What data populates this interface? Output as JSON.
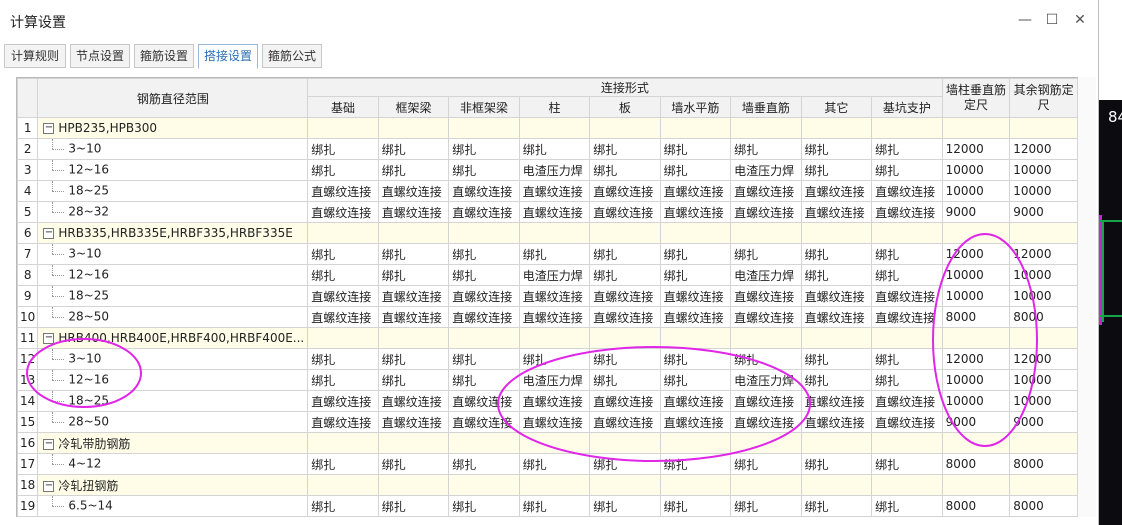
{
  "window": {
    "title": "计算设置",
    "minimize_glyph": "—",
    "maximize_glyph": "☐",
    "close_glyph": "✕"
  },
  "background": {
    "side_number": "84"
  },
  "tabs": [
    {
      "label": "计算规则",
      "active": false
    },
    {
      "label": "节点设置",
      "active": false
    },
    {
      "label": "箍筋设置",
      "active": false
    },
    {
      "label": "搭接设置",
      "active": true
    },
    {
      "label": "箍筋公式",
      "active": false
    }
  ],
  "table": {
    "header_range": "钢筋直径范围",
    "header_group": "连接形式",
    "header_wall_col": "墙柱垂直筋定尺",
    "header_other": "其余钢筋定尺",
    "columns": [
      "基础",
      "框架梁",
      "非框架梁",
      "柱",
      "板",
      "墙水平筋",
      "墙垂直筋",
      "其它",
      "基坑支护"
    ],
    "rows": [
      {
        "n": "1",
        "group": true,
        "label": "HPB235,HPB300"
      },
      {
        "n": "2",
        "label": "3~10",
        "cells": [
          "绑扎",
          "绑扎",
          "绑扎",
          "绑扎",
          "绑扎",
          "绑扎",
          "绑扎",
          "绑扎",
          "绑扎"
        ],
        "wall": "12000",
        "other": "12000"
      },
      {
        "n": "3",
        "label": "12~16",
        "cells": [
          "绑扎",
          "绑扎",
          "绑扎",
          "电渣压力焊",
          "绑扎",
          "绑扎",
          "电渣压力焊",
          "绑扎",
          "绑扎"
        ],
        "wall": "10000",
        "other": "10000"
      },
      {
        "n": "4",
        "label": "18~25",
        "cells": [
          "直螺纹连接",
          "直螺纹连接",
          "直螺纹连接",
          "直螺纹连接",
          "直螺纹连接",
          "直螺纹连接",
          "直螺纹连接",
          "直螺纹连接",
          "直螺纹连接"
        ],
        "wall": "10000",
        "other": "10000"
      },
      {
        "n": "5",
        "label": "28~32",
        "cells": [
          "直螺纹连接",
          "直螺纹连接",
          "直螺纹连接",
          "直螺纹连接",
          "直螺纹连接",
          "直螺纹连接",
          "直螺纹连接",
          "直螺纹连接",
          "直螺纹连接"
        ],
        "wall": "9000",
        "other": "9000"
      },
      {
        "n": "6",
        "group": true,
        "label": "HRB335,HRB335E,HRBF335,HRBF335E"
      },
      {
        "n": "7",
        "label": "3~10",
        "cells": [
          "绑扎",
          "绑扎",
          "绑扎",
          "绑扎",
          "绑扎",
          "绑扎",
          "绑扎",
          "绑扎",
          "绑扎"
        ],
        "wall": "12000",
        "other": "12000"
      },
      {
        "n": "8",
        "label": "12~16",
        "cells": [
          "绑扎",
          "绑扎",
          "绑扎",
          "电渣压力焊",
          "绑扎",
          "绑扎",
          "电渣压力焊",
          "绑扎",
          "绑扎"
        ],
        "wall": "10000",
        "other": "10000"
      },
      {
        "n": "9",
        "label": "18~25",
        "cells": [
          "直螺纹连接",
          "直螺纹连接",
          "直螺纹连接",
          "直螺纹连接",
          "直螺纹连接",
          "直螺纹连接",
          "直螺纹连接",
          "直螺纹连接",
          "直螺纹连接"
        ],
        "wall": "10000",
        "other": "10000"
      },
      {
        "n": "10",
        "label": "28~50",
        "cells": [
          "直螺纹连接",
          "直螺纹连接",
          "直螺纹连接",
          "直螺纹连接",
          "直螺纹连接",
          "直螺纹连接",
          "直螺纹连接",
          "直螺纹连接",
          "直螺纹连接"
        ],
        "wall": "8000",
        "other": "8000"
      },
      {
        "n": "11",
        "group": true,
        "label": "HRB400,HRB400E,HRBF400,HRBF400E..."
      },
      {
        "n": "12",
        "label": "3~10",
        "cells": [
          "绑扎",
          "绑扎",
          "绑扎",
          "绑扎",
          "绑扎",
          "绑扎",
          "绑扎",
          "绑扎",
          "绑扎"
        ],
        "wall": "12000",
        "other": "12000"
      },
      {
        "n": "13",
        "label": "12~16",
        "cells": [
          "绑扎",
          "绑扎",
          "绑扎",
          "电渣压力焊",
          "绑扎",
          "绑扎",
          "电渣压力焊",
          "绑扎",
          "绑扎"
        ],
        "wall": "10000",
        "other": "10000"
      },
      {
        "n": "14",
        "label": "18~25",
        "cells": [
          "直螺纹连接",
          "直螺纹连接",
          "直螺纹连接",
          "直螺纹连接",
          "直螺纹连接",
          "直螺纹连接",
          "直螺纹连接",
          "直螺纹连接",
          "直螺纹连接"
        ],
        "wall": "10000",
        "other": "10000"
      },
      {
        "n": "15",
        "label": "28~50",
        "cells": [
          "直螺纹连接",
          "直螺纹连接",
          "直螺纹连接",
          "直螺纹连接",
          "直螺纹连接",
          "直螺纹连接",
          "直螺纹连接",
          "直螺纹连接",
          "直螺纹连接"
        ],
        "wall": "9000",
        "other": "9000"
      },
      {
        "n": "16",
        "group": true,
        "label": "冷轧带肋钢筋"
      },
      {
        "n": "17",
        "label": "4~12",
        "cells": [
          "绑扎",
          "绑扎",
          "绑扎",
          "绑扎",
          "绑扎",
          "绑扎",
          "绑扎",
          "绑扎",
          "绑扎"
        ],
        "wall": "8000",
        "other": "8000"
      },
      {
        "n": "18",
        "group": true,
        "label": "冷轧扭钢筋"
      },
      {
        "n": "19",
        "label": "6.5~14",
        "cells": [
          "绑扎",
          "绑扎",
          "绑扎",
          "绑扎",
          "绑扎",
          "绑扎",
          "绑扎",
          "绑扎",
          "绑扎"
        ],
        "wall": "8000",
        "other": "8000"
      }
    ]
  },
  "annotations": {
    "color": "#e026e8"
  }
}
